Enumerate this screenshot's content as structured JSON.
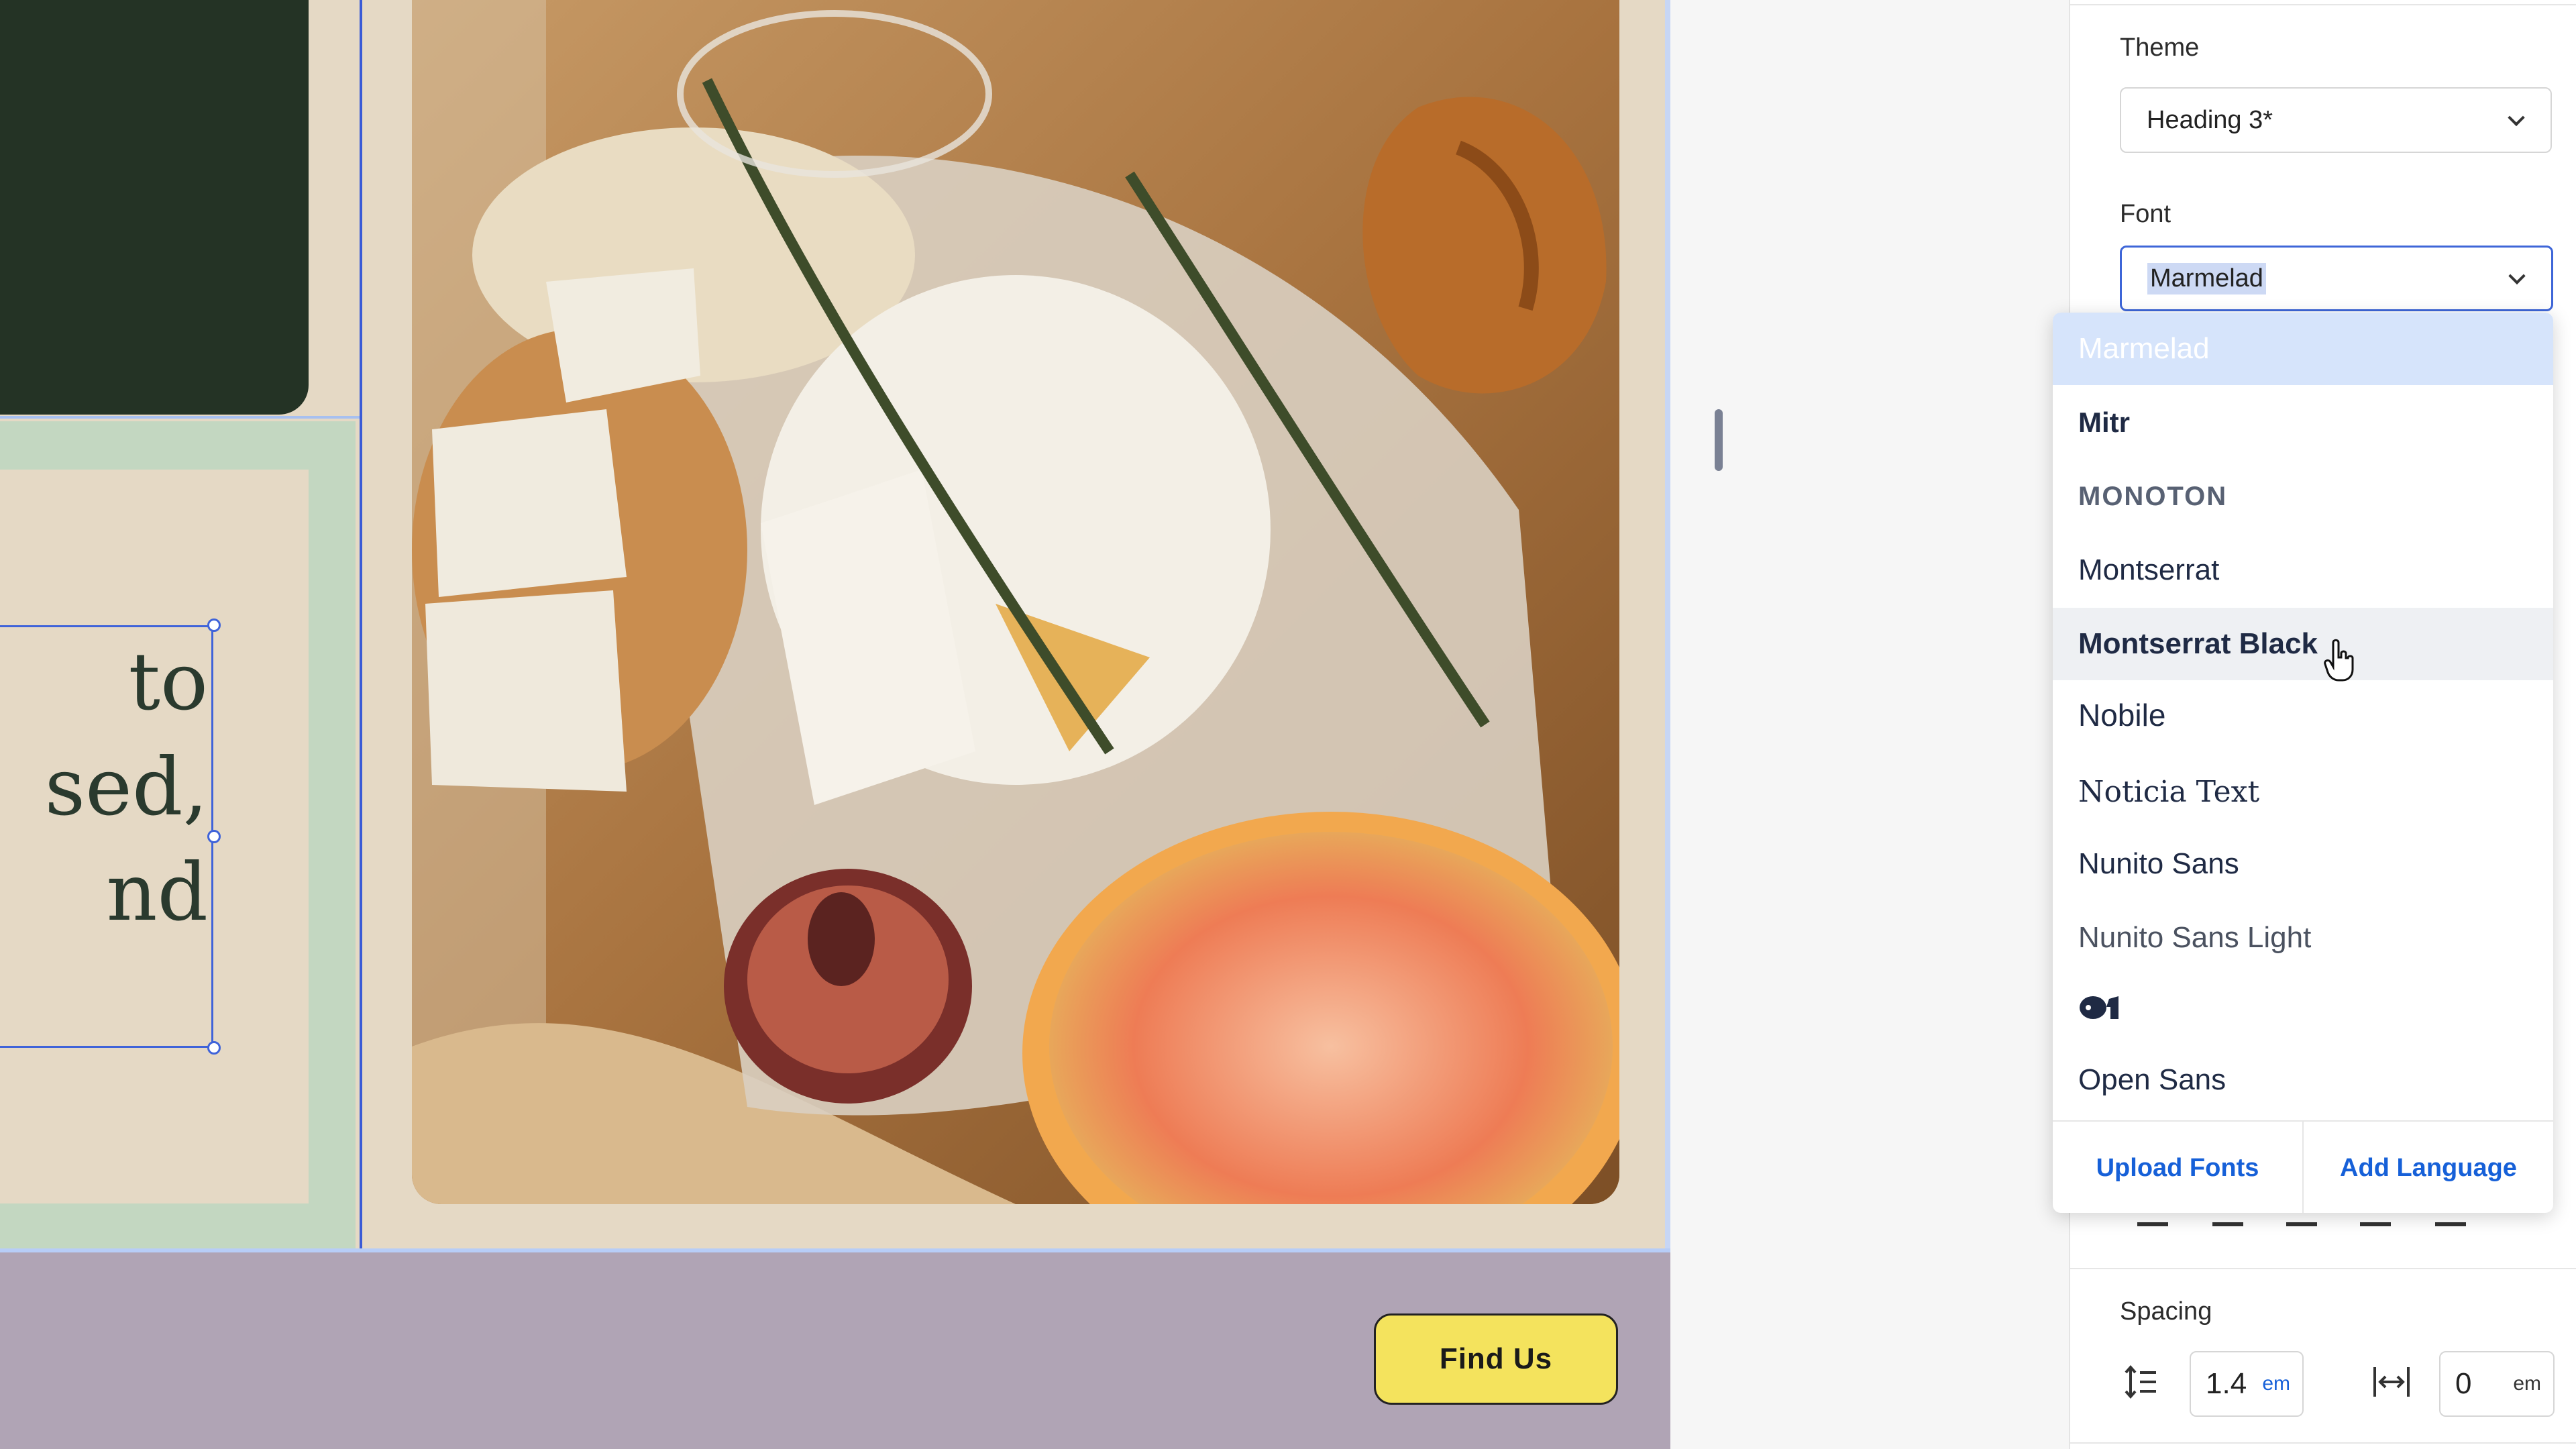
{
  "canvas": {
    "text_lines": [
      "to",
      "sed,",
      "nd"
    ],
    "find_us_label": "Find Us",
    "photo_alt": "cheese board photo"
  },
  "panel": {
    "theme_label": "Theme",
    "theme_value": "Heading 3*",
    "font_label": "Font",
    "font_value": "Marmelad",
    "spacing_label": "Spacing",
    "line_height_value": "1.4",
    "line_height_unit": "em",
    "letter_spacing_value": "0",
    "letter_spacing_unit": "em"
  },
  "dropdown": {
    "options": [
      "Marmelad",
      "Mitr",
      "MONOTON",
      "Montserrat",
      "Montserrat Black",
      "Nobile",
      "Noticia Text",
      "Nunito Sans",
      "Nunito Sans Light",
      "Open Sans"
    ],
    "upload_fonts": "Upload Fonts",
    "add_language": "Add Language"
  },
  "colors": {
    "accent": "#3e66d8",
    "link": "#1660d8",
    "button_yellow": "#f4e35d",
    "footer_band": "#b0a4b5",
    "dark_green": "#243325"
  },
  "icons": [
    "chevron-down-icon",
    "line-height-icon",
    "letter-spacing-icon",
    "pointer-hand-icon",
    "list-icons"
  ]
}
